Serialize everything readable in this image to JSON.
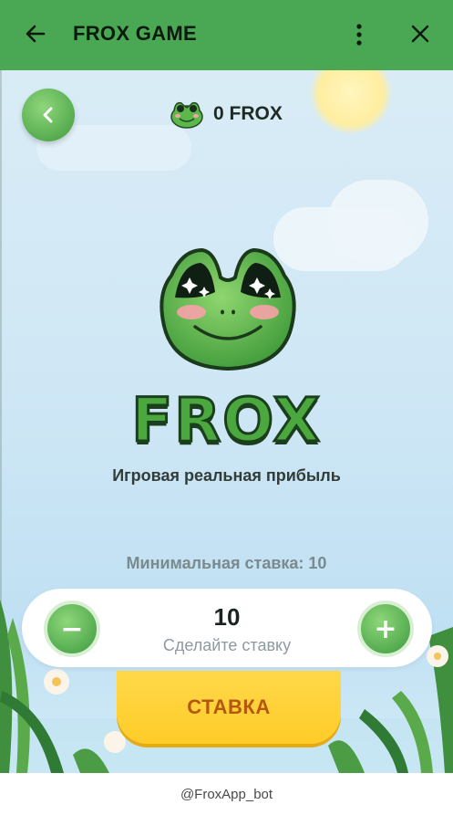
{
  "titlebar": {
    "title": "FROX GAME",
    "back_icon": "arrow-left-icon",
    "menu_icon": "kebab-menu-icon",
    "close_icon": "close-icon",
    "color": "#4aa855"
  },
  "header": {
    "back_button_icon": "chevron-left-icon",
    "balance": "0 FROX"
  },
  "hero": {
    "logo_text": "FROX",
    "tagline": "Игровая реальная прибыль"
  },
  "bet": {
    "min_label": "Минимальная ставка: 10",
    "value": "10",
    "hint": "Сделайте ставку",
    "minus_symbol": "−",
    "plus_symbol": "+",
    "submit_label": "СТАВКА"
  },
  "footer": {
    "bot_name": "@FroxApp_bot"
  },
  "colors": {
    "accent_green": "#4aa855",
    "button_yellow": "#ffd84a",
    "stake_text": "#b5570f"
  }
}
